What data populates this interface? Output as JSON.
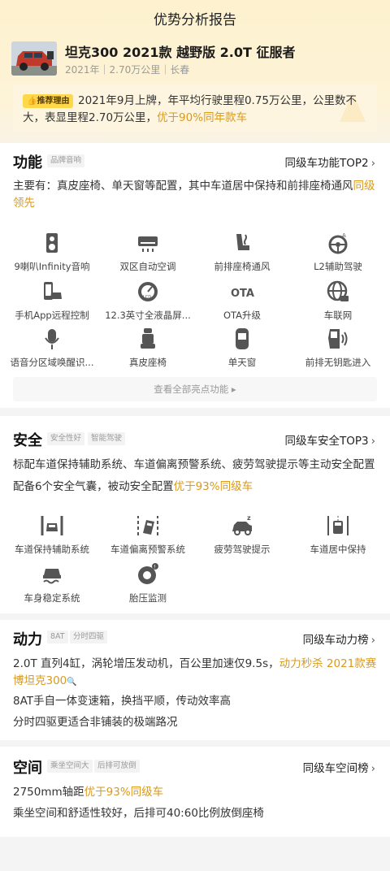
{
  "header": {
    "title": "优势分析报告"
  },
  "car": {
    "name": "坦克300 2021款 越野版 2.0T 征服者",
    "meta": "2021年｜2.70万公里｜长春"
  },
  "recommend": {
    "tag": "推荐理由",
    "text": "2021年9月上牌，年平均行驶里程0.75万公里，公里数不大，表显里程2.70万公里，",
    "highlight": "优于90%同年款车"
  },
  "features": {
    "title": "功能",
    "badge": "品牌音响",
    "rank": "同级车功能TOP2",
    "desc": "主要有：真皮座椅、单天窗等配置，其中车道居中保持和前排座椅通风",
    "desc_hl": "同级领先",
    "items": [
      {
        "label": "9喇叭Infinity音响",
        "icon": "speaker-icon"
      },
      {
        "label": "双区自动空调",
        "icon": "air-conditioner-icon"
      },
      {
        "label": "前排座椅通风",
        "icon": "seat-ventilation-icon"
      },
      {
        "label": "L2辅助驾驶",
        "icon": "steering-assist-icon"
      },
      {
        "label": "手机App远程控制",
        "icon": "phone-remote-icon"
      },
      {
        "label": "12.3英寸全液晶屏...",
        "icon": "lcd-gauge-icon"
      },
      {
        "label": "OTA升级",
        "icon": "ota-icon"
      },
      {
        "label": "车联网",
        "icon": "globe-icon"
      },
      {
        "label": "语音分区域唤醒识...",
        "icon": "microphone-icon"
      },
      {
        "label": "真皮座椅",
        "icon": "leather-seat-icon"
      },
      {
        "label": "单天窗",
        "icon": "sunroof-icon"
      },
      {
        "label": "前排无钥匙进入",
        "icon": "keyless-door-icon"
      }
    ],
    "view_all": "查看全部亮点功能"
  },
  "safety": {
    "title": "安全",
    "badges": [
      "安全性好",
      "智能驾驶"
    ],
    "rank": "同级车安全TOP3",
    "desc1": "标配车道保持辅助系统、车道偏离预警系统、疲劳驾驶提示等主动安全配置",
    "desc2": "配备6个安全气囊，被动安全配置",
    "desc2_hl": "优于93%同级车",
    "items": [
      {
        "label": "车道保持辅助系统",
        "icon": "lane-keep-icon"
      },
      {
        "label": "车道偏离预警系统",
        "icon": "lane-departure-icon"
      },
      {
        "label": "疲劳驾驶提示",
        "icon": "fatigue-icon"
      },
      {
        "label": "车道居中保持",
        "icon": "lane-center-icon"
      },
      {
        "label": "车身稳定系统",
        "icon": "stability-icon"
      },
      {
        "label": "胎压监测",
        "icon": "tire-pressure-icon"
      }
    ]
  },
  "power": {
    "title": "动力",
    "badges": [
      "8AT",
      "分时四驱"
    ],
    "rank": "同级车动力榜",
    "line1": "2.0T 直列4缸，涡轮增压发动机，百公里加速仅9.5s，",
    "line1_hl": "动力秒杀 2021款赛博坦克300",
    "line2": "8AT手自一体变速箱，换挡平顺，传动效率高",
    "line3": "分时四驱更适合非铺装的极端路况"
  },
  "space": {
    "title": "空间",
    "badges": [
      "乘坐空间大",
      "后排可放倒"
    ],
    "rank": "同级车空间榜",
    "line1": "2750mm轴距",
    "line1_hl": "优于93%同级车",
    "line2": "乘坐空间和舒适性较好，后排可40:60比例放倒座椅"
  },
  "colors": {
    "accent": "#d99a1e",
    "tag_bg": "#ffd84a",
    "header_bg": "#fdf1cf"
  }
}
